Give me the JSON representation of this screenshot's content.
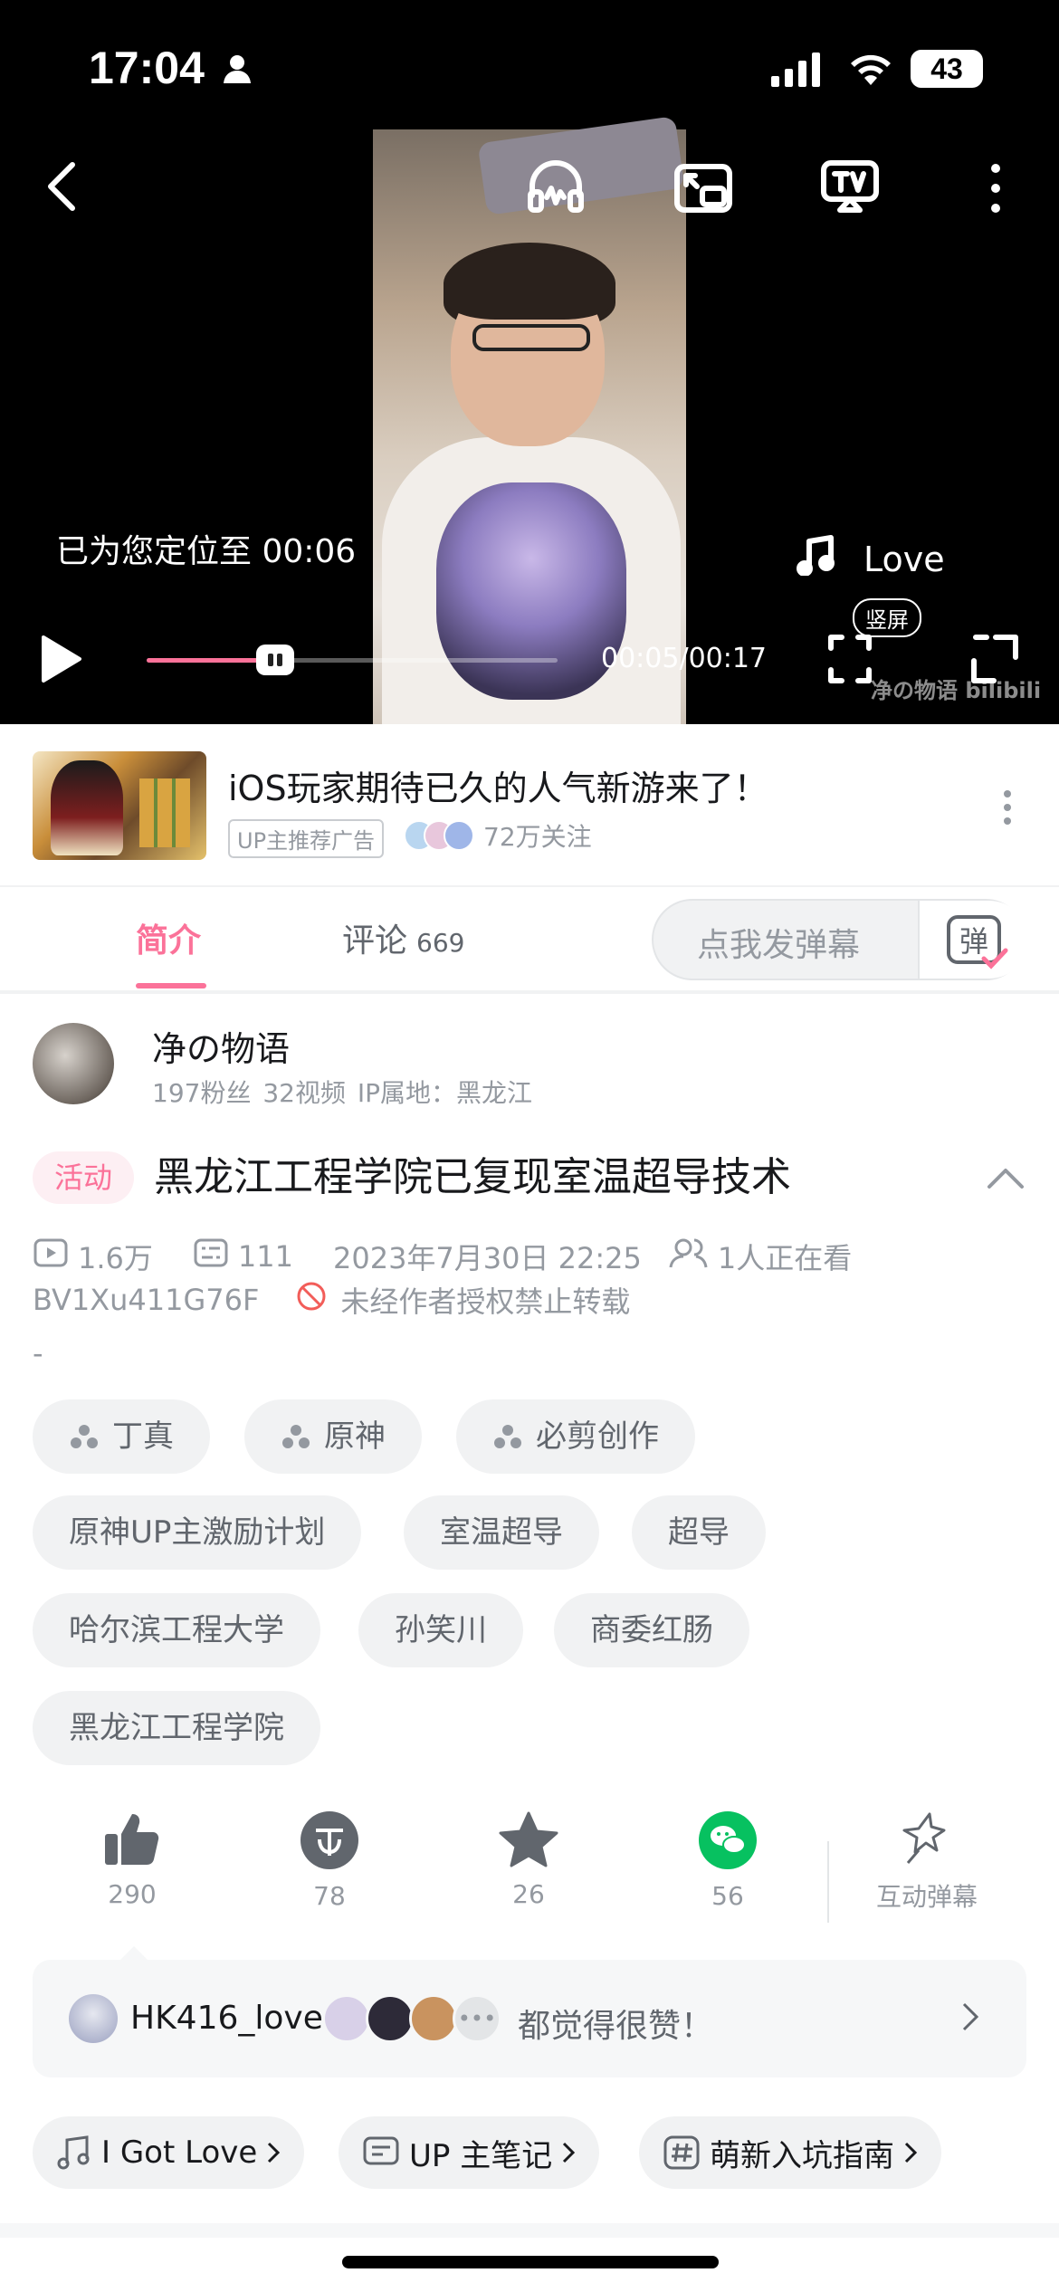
{
  "status_bar": {
    "time": "17:04",
    "battery": "43"
  },
  "player": {
    "toast": "已为您定位至 00:06",
    "song": "Love",
    "time": "00:05/00:17",
    "progress": 0.27,
    "vertical_badge": "竖屏",
    "watermark": "净の物语 bilibili"
  },
  "ad": {
    "title": "iOS玩家期待已久的人气新游来了！",
    "badge": "UP主推荐广告",
    "followers": "72万关注"
  },
  "tabs": {
    "intro": "简介",
    "comments": "评论",
    "comments_count": "669"
  },
  "danmu": {
    "placeholder": "点我发弹幕",
    "button": "弹"
  },
  "uploader": {
    "name": "净の物语",
    "stats": "197粉丝  32视频  IP属地：黑龙江"
  },
  "video": {
    "activity_tag": "活动",
    "title": "黑龙江工程学院已复现室温超导技术",
    "views": "1.6万",
    "danmaku": "111",
    "date": "2023年7月30日  22:25",
    "watching": "1人正在看",
    "bvid": "BV1Xu411G76F",
    "copyright": "未经作者授权禁止转载",
    "description": "-"
  },
  "tags": [
    {
      "label": "丁真"
    },
    {
      "label": "原神"
    },
    {
      "label": "必剪创作"
    },
    {
      "label": "原神UP主激励计划"
    },
    {
      "label": "室温超导"
    },
    {
      "label": "超导"
    },
    {
      "label": "哈尔滨工程大学"
    },
    {
      "label": "孙笑川"
    },
    {
      "label": "商委红肠"
    },
    {
      "label": "黑龙江工程学院"
    }
  ],
  "actions": {
    "like": "290",
    "coin": "78",
    "favorite": "26",
    "share": "56",
    "interactive": "互动弹幕"
  },
  "likers": {
    "first": "HK416_love",
    "text": "都觉得很赞！"
  },
  "chips": {
    "music": "I Got Love",
    "notes": "UP 主笔记",
    "topic": "萌新入坑指南"
  },
  "colors": {
    "accent": "#fb7299",
    "wechat": "#07c160"
  }
}
